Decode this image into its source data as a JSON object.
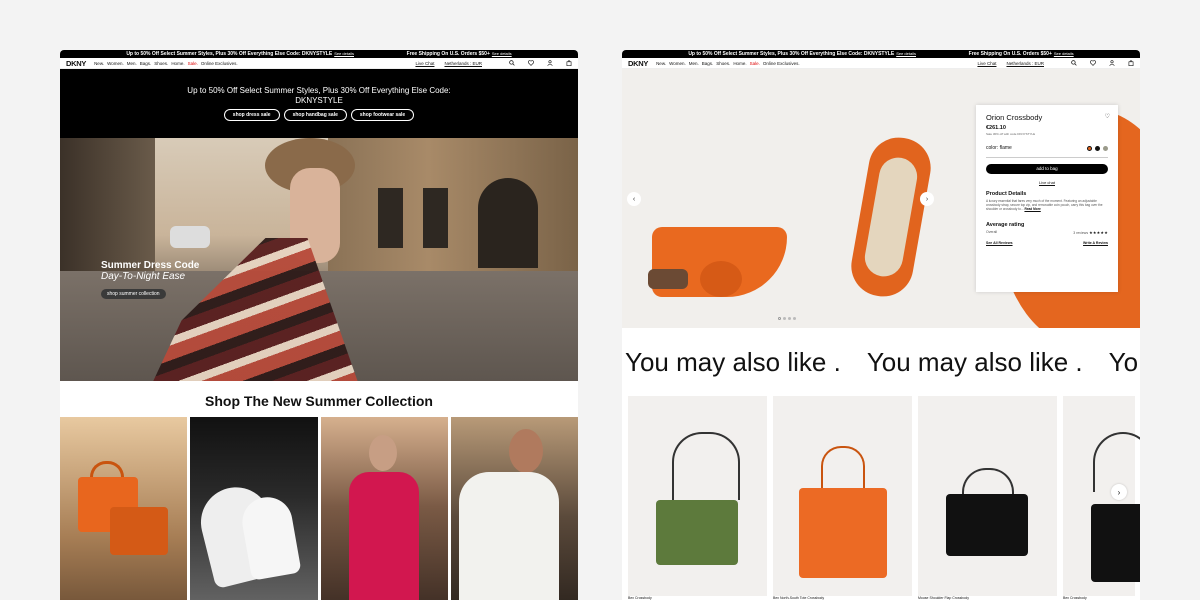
{
  "promo": {
    "left": "Up to 50% Off Select Summer Styles, Plus 30% Off Everything Else Code: DKNYSTYLE",
    "left_link": "See details",
    "right": "Free Shipping On U.S. Orders $50+",
    "right_link": "See details"
  },
  "nav": {
    "logo": "DKNY",
    "links": [
      "New.",
      "Women.",
      "Men.",
      "Bags.",
      "Shoes.",
      "Home.",
      "Sale.",
      "Online Exclusives."
    ],
    "live_chat": "Live Chat",
    "locale": "Netherlands : EUR",
    "icons": [
      "search-icon",
      "heart-icon",
      "user-icon",
      "bag-icon"
    ]
  },
  "left": {
    "hero_line1": "Up to 50% Off Select Summer Styles, Plus 30% Off Everything Else Code:",
    "hero_line2": "DKNYSTYLE",
    "hero_buttons": [
      "shop dress sale",
      "shop handbag sale",
      "shop footwear sale"
    ],
    "caption_title": "Summer Dress Code",
    "caption_sub": "Day-To-Night Ease",
    "caption_button": "shop summer collection",
    "section_title": "Shop The New Summer Collection"
  },
  "right": {
    "product": {
      "name": "Orion Crossbody",
      "price": "€261.10",
      "price_note": "Sale 30% off with code DKNYSTYLE",
      "color_label": "color: flame",
      "swatches": [
        "#e4661f",
        "#111111",
        "#9a9a8a"
      ],
      "add_to_bag": "add to bag",
      "live_chat": "Live chat",
      "details_title": "Product Details",
      "details_text": "A luxury essential that fares very much of the moment. Featuring an adjustable crossbody strap, secure top zip, and removable coin pouch, carry this bag over the shoulder or crossbody to...",
      "read_more": "Read More",
      "rating_title": "Average rating",
      "rating_label": "Overall",
      "reviews_count": "3 reviews",
      "stars": "★★★★★",
      "see_reviews": "See All Reviews",
      "write_review": "Write A Review"
    },
    "ymal": [
      "You may also like .",
      "You may also like .",
      "Yo"
    ],
    "cards": [
      {
        "name": "Bex Crossbody",
        "color": "#5d7a3c"
      },
      {
        "name": "Bex North-South Tote Crossbody",
        "color": "#ec6a24"
      },
      {
        "name": "Mouse Shoulder Flap Crossbody",
        "color": "#111111"
      },
      {
        "name": "Bex Crossbody",
        "color": "#111111"
      }
    ]
  }
}
